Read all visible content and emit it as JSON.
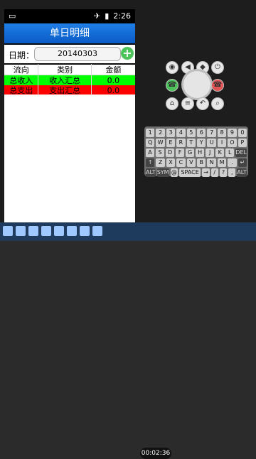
{
  "status_bar": {
    "time": "2:26"
  },
  "app": {
    "title": "单日明细",
    "date_label": "日期：",
    "date_value": "20140303",
    "add_icon": "plus-circle-icon"
  },
  "table": {
    "headers": [
      "流向",
      "类别",
      "金额"
    ],
    "rows": [
      {
        "flow": "总收入",
        "category": "收入汇总",
        "amount": "0.0"
      },
      {
        "flow": "总支出",
        "category": "支出汇总",
        "amount": "0.0"
      }
    ]
  },
  "keyboard": {
    "rows": [
      [
        "1",
        "2",
        "3",
        "4",
        "5",
        "6",
        "7",
        "8",
        "9",
        "0"
      ],
      [
        "Q",
        "W",
        "E",
        "R",
        "T",
        "Y",
        "U",
        "I",
        "O",
        "P"
      ],
      [
        "A",
        "S",
        "D",
        "F",
        "G",
        "H",
        "J",
        "K",
        "L",
        "DEL"
      ],
      [
        "↑",
        "Z",
        "X",
        "C",
        "V",
        "B",
        "N",
        "M",
        ".",
        "↵"
      ],
      [
        "ALT",
        "SYM",
        "@",
        "SPACE",
        "→",
        "/",
        "?",
        ",",
        "ALT"
      ]
    ]
  },
  "taskbar": {
    "timer": "00:02:36"
  },
  "colors": {
    "income_row": "#00ff00",
    "expense_row": "#ff0000",
    "title_bar": "#1f7fe6"
  }
}
